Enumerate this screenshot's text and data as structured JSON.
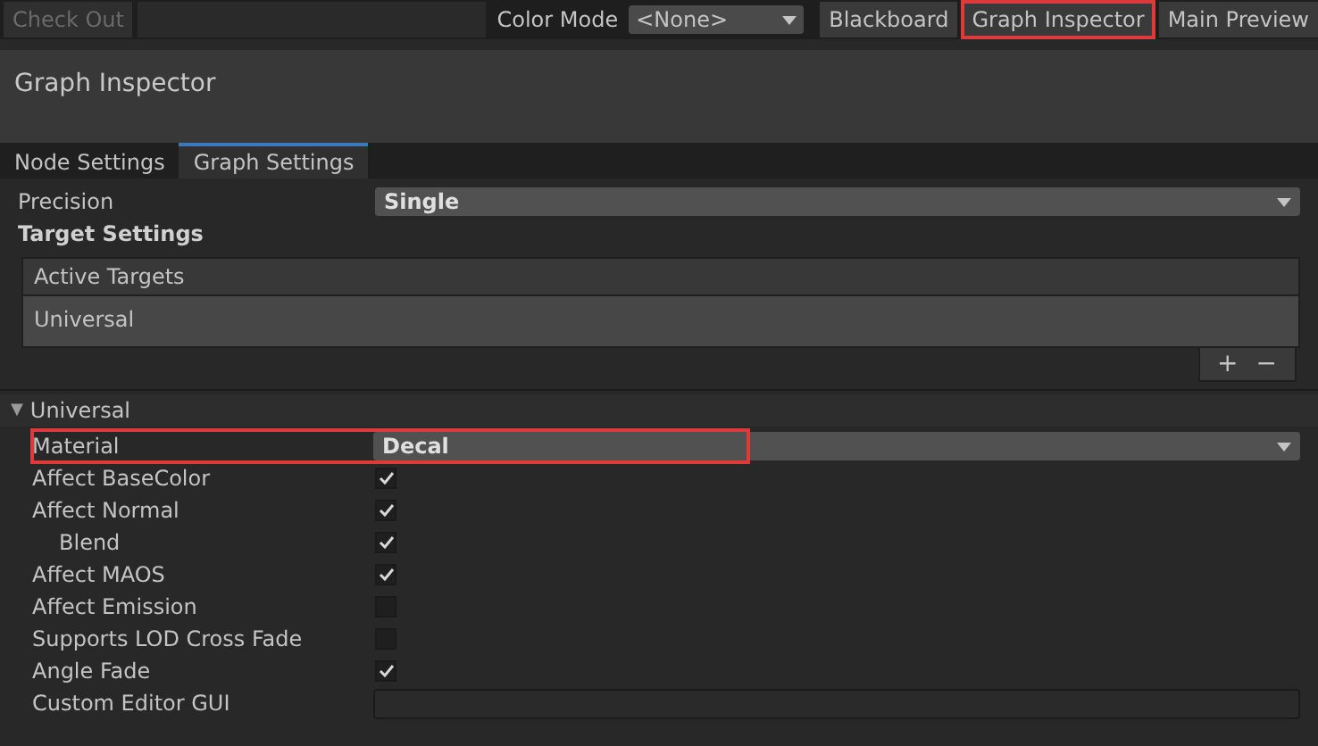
{
  "toolbar": {
    "check_out": {
      "label": "Check Out",
      "disabled": true
    },
    "color_mode": {
      "label": "Color Mode",
      "value": "<None>"
    },
    "buttons": [
      {
        "label": "Blackboard",
        "highlighted": false
      },
      {
        "label": "Graph Inspector",
        "highlighted": true
      },
      {
        "label": "Main Preview",
        "highlighted": false
      }
    ]
  },
  "panel": {
    "title": "Graph Inspector"
  },
  "tabs": [
    {
      "label": "Node Settings",
      "selected": false
    },
    {
      "label": "Graph Settings",
      "selected": true
    }
  ],
  "precision": {
    "label": "Precision",
    "value": "Single"
  },
  "target_settings": {
    "heading": "Target Settings",
    "list_header": "Active Targets",
    "items": [
      "Universal"
    ],
    "add": "+",
    "remove": "−"
  },
  "foldout": {
    "label": "Universal",
    "expanded": true,
    "arrow": "▼",
    "rows": [
      {
        "kind": "dropdown",
        "label": "Material",
        "value": "Decal",
        "highlighted": true
      },
      {
        "kind": "checkbox",
        "label": "Affect BaseColor",
        "checked": true
      },
      {
        "kind": "checkbox",
        "label": "Affect Normal",
        "checked": true,
        "children": [
          {
            "kind": "checkbox",
            "label": "Blend",
            "checked": true
          }
        ]
      },
      {
        "kind": "checkbox",
        "label": "Affect MAOS",
        "checked": true
      },
      {
        "kind": "checkbox",
        "label": "Affect Emission",
        "checked": false
      },
      {
        "kind": "checkbox",
        "label": "Supports LOD Cross Fade",
        "checked": false
      },
      {
        "kind": "checkbox",
        "label": "Angle Fade",
        "checked": true
      },
      {
        "kind": "text_field",
        "label": "Custom Editor GUI"
      }
    ]
  }
}
